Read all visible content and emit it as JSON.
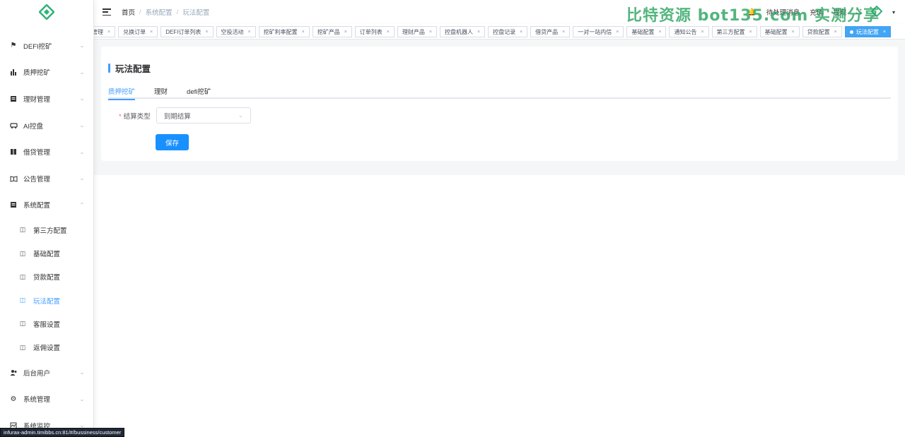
{
  "sidebar": {
    "menu_top": [
      {
        "label": "DEFI挖矿",
        "icon": "worker-icon"
      },
      {
        "label": "质押挖矿",
        "icon": "bar-chart-icon"
      },
      {
        "label": "理财管理",
        "icon": "document-icon"
      },
      {
        "label": "AI控盘",
        "icon": "car-icon"
      },
      {
        "label": "借贷管理",
        "icon": "book-icon"
      },
      {
        "label": "公告管理",
        "icon": "open-book-icon"
      },
      {
        "label": "系统配置",
        "icon": "document-icon"
      }
    ],
    "submenu": [
      {
        "label": "第三方配置"
      },
      {
        "label": "基础配置"
      },
      {
        "label": "贷款配置"
      },
      {
        "label": "玩法配置"
      },
      {
        "label": "客服设置"
      },
      {
        "label": "返佣设置"
      }
    ],
    "menu_bottom": [
      {
        "label": "后台用户",
        "icon": "users-icon"
      },
      {
        "label": "系统管理",
        "icon": "gear-icon"
      },
      {
        "label": "系统监控",
        "icon": "monitor-icon"
      }
    ]
  },
  "header": {
    "breadcrumb": [
      "首页",
      "系统配置",
      "玩法配置"
    ],
    "right": {
      "pending": "待处理消息",
      "recharge": "充值",
      "withdraw": "提现"
    },
    "watermark": "比特资源 bot135.com 实测分享"
  },
  "tags": [
    "管理",
    "兑换订单",
    "DEFI订单列表",
    "空投活动",
    "挖矿利率配置",
    "挖矿产品",
    "订单列表",
    "理财产品",
    "控盘机器人",
    "控盘记录",
    "借贷产品",
    "一对一站内信",
    "基础配置",
    "通知公告",
    "第三方配置",
    "基础配置",
    "贷款配置",
    "玩法配置"
  ],
  "main": {
    "title": "玩法配置",
    "tabs": [
      "质押挖矿",
      "理财",
      "defi挖矿"
    ],
    "form": {
      "required_mark": "*",
      "settle_label": "结算类型",
      "settle_value": "到期结算"
    },
    "save_label": "保存"
  },
  "statusbar": {
    "url": "infurax-admin.timibbs.cn:81/#/bussiness/customer"
  }
}
